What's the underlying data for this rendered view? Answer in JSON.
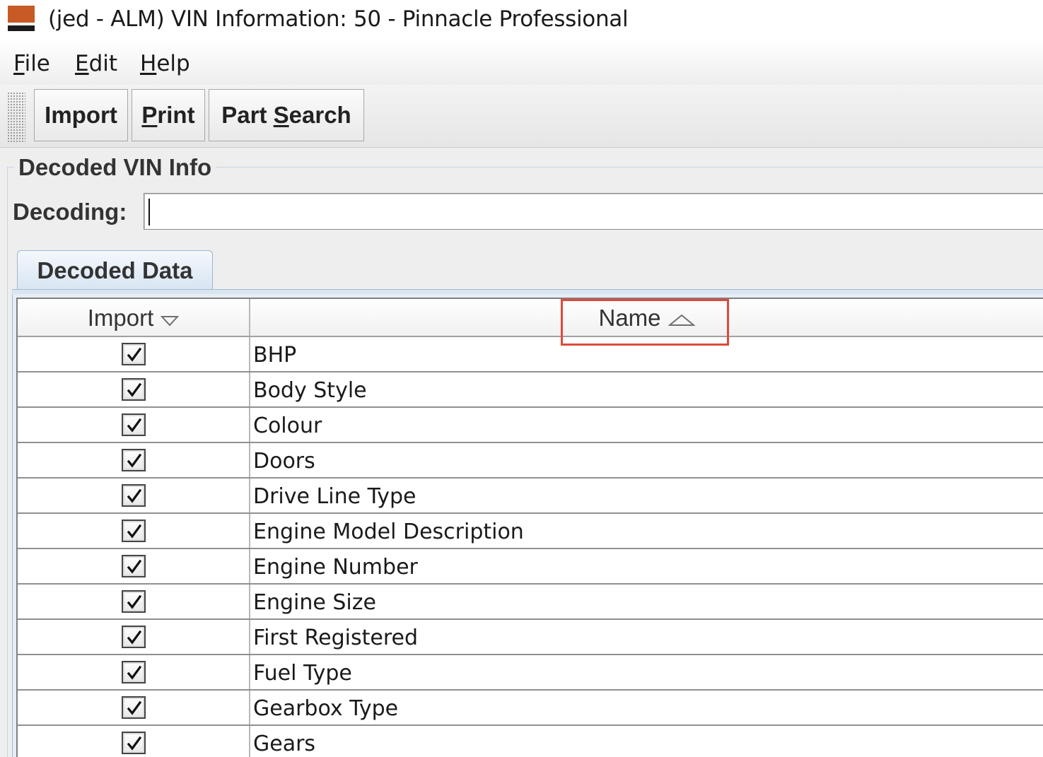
{
  "window": {
    "title": "(jed - ALM) VIN Information: 50 - Pinnacle Professional",
    "icon": "pinnacle-app-icon"
  },
  "menubar": {
    "items": [
      {
        "mnemonic": "F",
        "rest": "ile"
      },
      {
        "mnemonic": "E",
        "rest": "dit"
      },
      {
        "mnemonic": "H",
        "rest": "elp"
      }
    ]
  },
  "toolbar": {
    "import": {
      "before": "Import",
      "mnemonic": "",
      "after": ""
    },
    "print": {
      "before": "",
      "mnemonic": "P",
      "after": "rint"
    },
    "part_search": {
      "before": "Part ",
      "mnemonic": "S",
      "after": "earch"
    }
  },
  "decoded_vin": {
    "group_title": "Decoded VIN Info",
    "decoding_label": "Decoding:",
    "decoding_value": ""
  },
  "tabs": [
    {
      "label": "Decoded Data",
      "selected": true
    }
  ],
  "table": {
    "columns": [
      {
        "label": "Import",
        "sort": "descending-icon"
      },
      {
        "label": "Name",
        "sort": "ascending-icon",
        "highlighted": true
      }
    ],
    "rows": [
      {
        "import": true,
        "name": "BHP"
      },
      {
        "import": true,
        "name": "Body Style"
      },
      {
        "import": true,
        "name": "Colour"
      },
      {
        "import": true,
        "name": "Doors"
      },
      {
        "import": true,
        "name": "Drive Line Type"
      },
      {
        "import": true,
        "name": "Engine Model Description"
      },
      {
        "import": true,
        "name": "Engine Number"
      },
      {
        "import": true,
        "name": "Engine Size"
      },
      {
        "import": true,
        "name": "First Registered"
      },
      {
        "import": true,
        "name": "Fuel Type"
      },
      {
        "import": true,
        "name": "Gearbox Type"
      },
      {
        "import": true,
        "name": "Gears"
      }
    ]
  },
  "colors": {
    "highlight": "#e0493b",
    "app_icon": "#c85a26",
    "tab_fill": "#d7e4f2"
  }
}
